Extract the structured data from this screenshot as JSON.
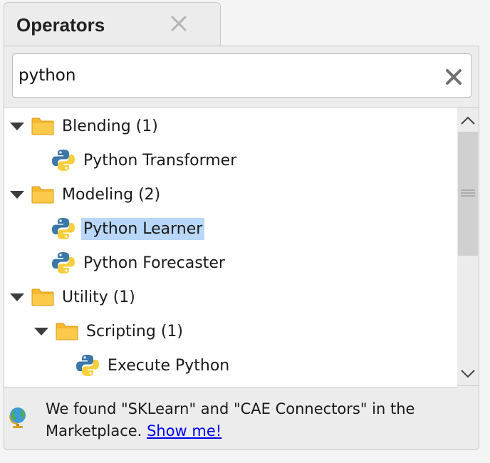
{
  "panel": {
    "tab_title": "Operators"
  },
  "search": {
    "value": "python"
  },
  "tree": {
    "items": [
      {
        "label": "Blending (1)",
        "type": "folder"
      },
      {
        "label": "Python Transformer",
        "type": "operator"
      },
      {
        "label": "Modeling (2)",
        "type": "folder"
      },
      {
        "label": "Python Learner",
        "type": "operator",
        "selected": true
      },
      {
        "label": "Python Forecaster",
        "type": "operator"
      },
      {
        "label": "Utility (1)",
        "type": "folder"
      },
      {
        "label": "Scripting (1)",
        "type": "folder"
      },
      {
        "label": "Execute Python",
        "type": "operator"
      }
    ]
  },
  "footer": {
    "message_line1": "We found \"SKLearn\" and \"CAE Connectors\" in the",
    "message_line2": "Marketplace.",
    "link": "Show me!"
  },
  "colors": {
    "selection": "#b9d7f8",
    "folder": "#f5b82e",
    "python_blue": "#3b77a8",
    "python_yellow": "#f7cf3e",
    "link": "#0000ee"
  },
  "icons": [
    "close-icon",
    "clear-search-icon",
    "expand-arrow-icon",
    "folder-icon",
    "python-icon",
    "scroll-up-icon",
    "scroll-down-icon",
    "globe-icon"
  ]
}
